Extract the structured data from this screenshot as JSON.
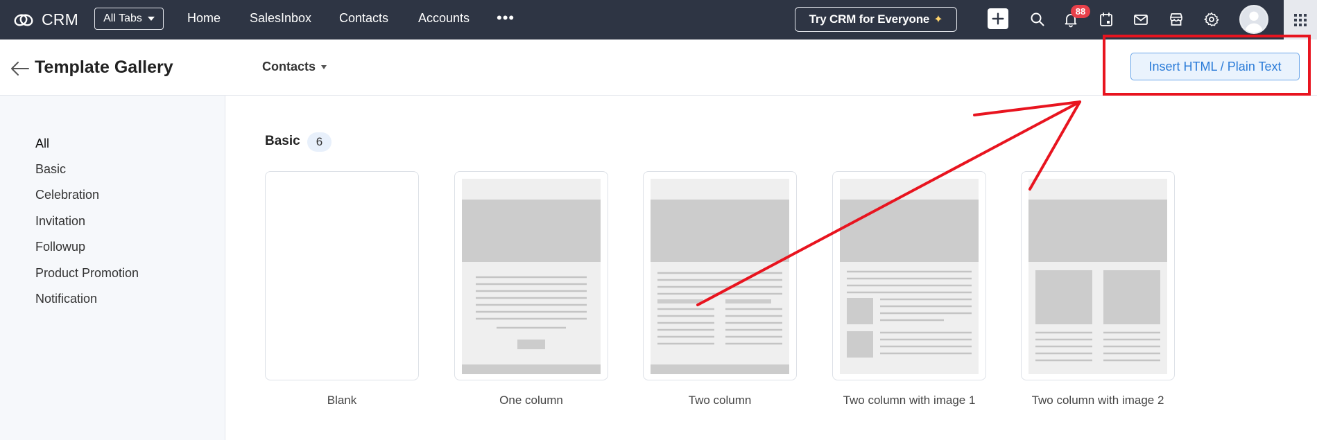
{
  "topbar": {
    "app_name": "CRM",
    "all_tabs_label": "All Tabs",
    "nav": [
      "Home",
      "SalesInbox",
      "Contacts",
      "Accounts"
    ],
    "more_label": "•••",
    "try_label": "Try CRM for Everyone",
    "notification_count": "88"
  },
  "header": {
    "title": "Template Gallery",
    "module": "Contacts",
    "insert_button": "Insert HTML / Plain Text"
  },
  "sidebar": {
    "items": [
      "All",
      "Basic",
      "Celebration",
      "Invitation",
      "Followup",
      "Product Promotion",
      "Notification"
    ]
  },
  "section": {
    "title": "Basic",
    "count": "6"
  },
  "templates": [
    {
      "label": "Blank"
    },
    {
      "label": "One column"
    },
    {
      "label": "Two column"
    },
    {
      "label": "Two column with image 1"
    },
    {
      "label": "Two column with image 2"
    }
  ],
  "colors": {
    "topbar": "#2e3544",
    "accent": "#2a7bd8",
    "annotation": "#e8141f",
    "badge": "#e8404a"
  }
}
